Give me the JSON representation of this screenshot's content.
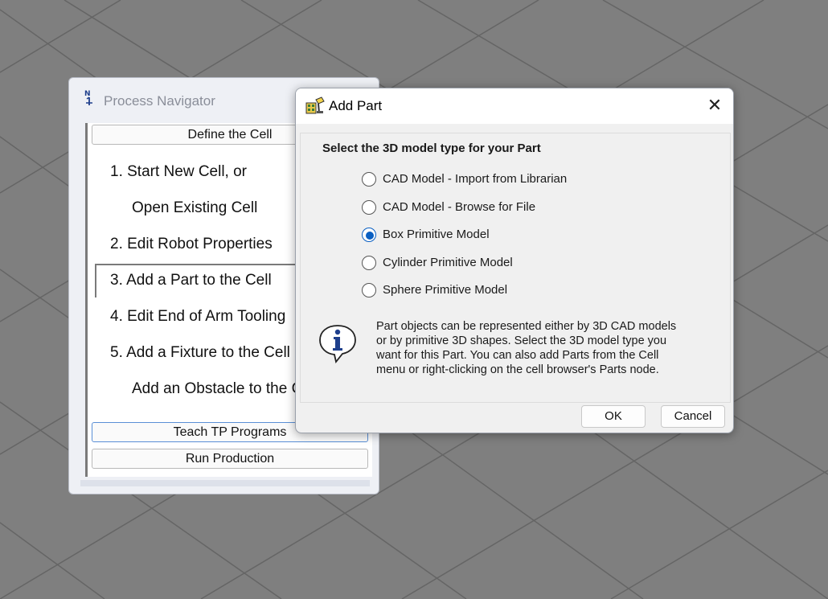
{
  "process_navigator": {
    "title": "Process Navigator",
    "define_cell_label": "Define the Cell",
    "steps": [
      "1.  Start New Cell, or",
      "Open Existing Cell",
      "2.  Edit Robot Properties",
      "3.  Add a Part to the Cell",
      "4.  Edit End of Arm Tooling",
      "5.  Add a Fixture to the Cell",
      "Add an Obstacle to the Cell"
    ],
    "teach_label": "Teach TP Programs",
    "run_label": "Run Production"
  },
  "dialog": {
    "title": "Add Part",
    "close_label": "✕",
    "heading": "Select the 3D model type for your Part",
    "options": [
      "CAD Model - Import from Librarian",
      "CAD Model - Browse for File",
      "Box Primitive Model",
      "Cylinder Primitive Model",
      "Sphere Primitive Model"
    ],
    "selected_option": "Box Primitive Model",
    "info_lines": [
      "Part objects can be represented either by 3D CAD models",
      "or by primitive 3D shapes.  Select the 3D model type you",
      "want for this Part.  You can also add Parts from the Cell",
      "menu or right-clicking on the cell browser's Parts node."
    ],
    "ok_label": "OK",
    "cancel_label": "Cancel"
  },
  "colors": {
    "background": "#7f7f7f",
    "grid_lines": "#656565",
    "accent": "#0a5fc2"
  },
  "icons": {
    "navigator_icon": "navigator-icon",
    "dialog_icon": "add-part-icon",
    "info_icon": "info-icon",
    "close_icon": "close-icon"
  }
}
